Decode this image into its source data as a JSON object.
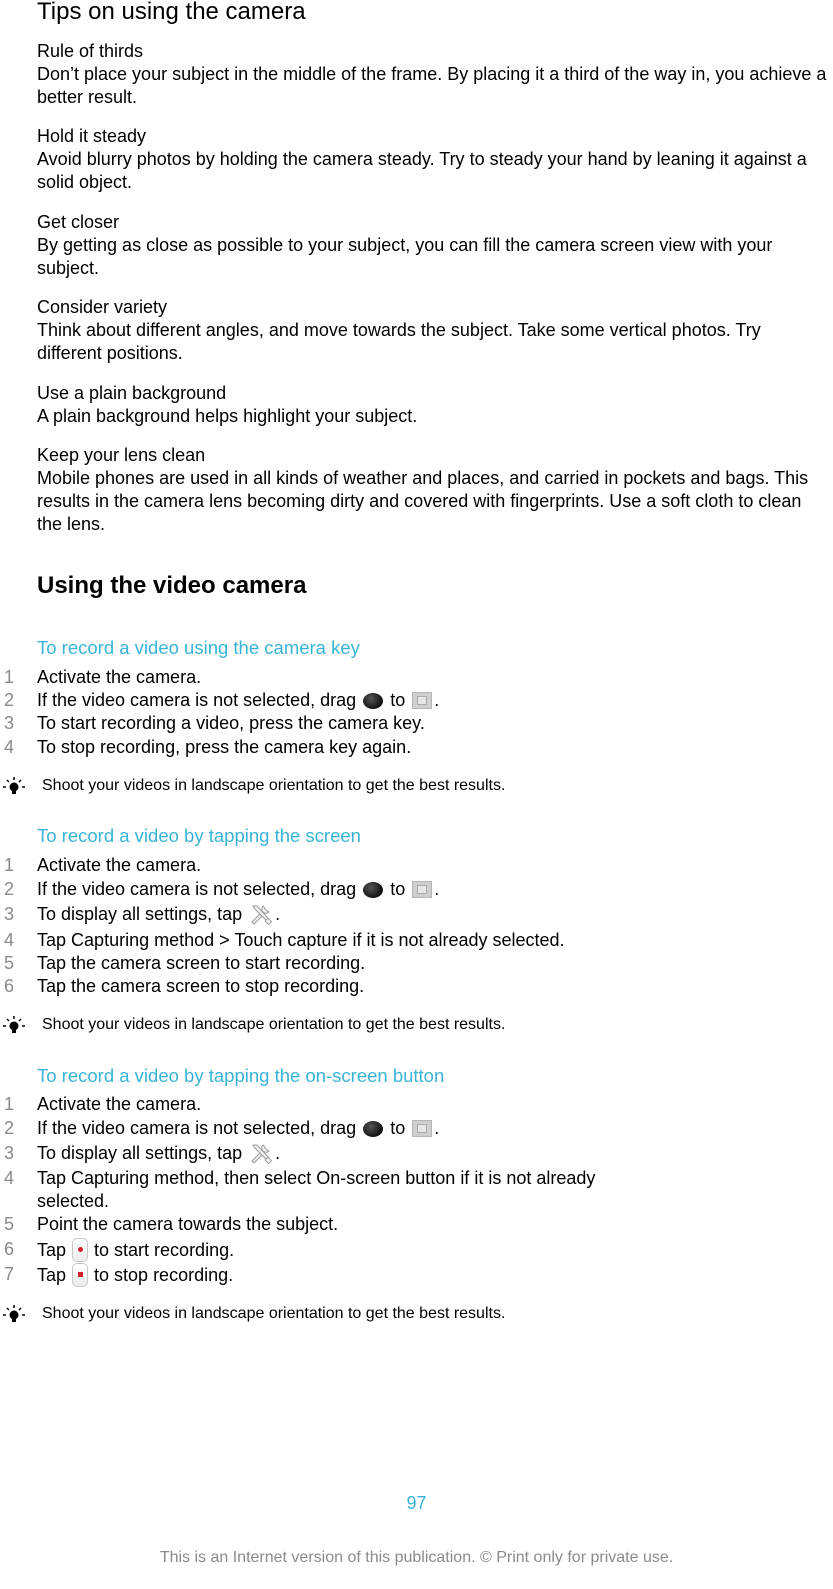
{
  "tips": {
    "title": "Tips on using the camera",
    "items": [
      {
        "heading": "Rule of thirds",
        "body": "Don’t place your subject in the middle of the frame. By placing it a third of the way in, you achieve a better result."
      },
      {
        "heading": "Hold it steady",
        "body": "Avoid blurry photos by holding the camera steady. Try to steady your hand by leaning it against a solid object."
      },
      {
        "heading": "Get closer",
        "body": "By getting as close as possible to your subject, you can fill the camera screen view with your subject."
      },
      {
        "heading": "Consider variety",
        "body": "Think about different angles, and move towards the subject. Take some vertical photos. Try different positions."
      },
      {
        "heading": "Use a plain background",
        "body": "A plain background helps highlight your subject."
      },
      {
        "heading": "Keep your lens clean",
        "body": "Mobile phones are used in all kinds of weather and places, and carried in pockets and bags. This results in the camera lens becoming dirty and covered with fingerprints. Use a soft cloth to clean the lens."
      }
    ]
  },
  "video": {
    "title": "Using the video camera",
    "procedures": [
      {
        "title": "To record a video using the camera key",
        "steps": [
          {
            "n": "1",
            "text": "Activate the camera."
          },
          {
            "n": "2",
            "pre": "If the video camera is not selected, drag",
            "mid": "to",
            "post": "."
          },
          {
            "n": "3",
            "text": "To start recording a video, press the camera key."
          },
          {
            "n": "4",
            "text": "To stop recording, press the camera key again."
          }
        ],
        "note": "Shoot your videos in landscape orientation to get the best results."
      },
      {
        "title": "To record a video by tapping the screen",
        "steps": [
          {
            "n": "1",
            "text": "Activate the camera."
          },
          {
            "n": "2",
            "pre": "If the video camera is not selected, drag",
            "mid": "to",
            "post": "."
          },
          {
            "n": "3",
            "pre": "To display all settings, tap",
            "post": "."
          },
          {
            "n": "4",
            "pre": "Tap",
            "b1": "Capturing method",
            "mid": ">",
            "b2": "Touch capture",
            "post": "if it is not already selected."
          },
          {
            "n": "5",
            "text": "Tap the camera screen to start recording."
          },
          {
            "n": "6",
            "text": "Tap the camera screen to stop recording."
          }
        ],
        "note": "Shoot your videos in landscape orientation to get the best results."
      },
      {
        "title": "To record a video by tapping the on-screen button",
        "steps": [
          {
            "n": "1",
            "text": "Activate the camera."
          },
          {
            "n": "2",
            "pre": "If the video camera is not selected, drag",
            "mid": "to",
            "post": "."
          },
          {
            "n": "3",
            "pre": "To display all settings, tap",
            "post": "."
          },
          {
            "n": "4",
            "pre": "Tap",
            "b1": "Capturing method",
            "mid": ", then select",
            "b2": "On-screen button",
            "post": "if it is not already",
            "line2": "selected."
          },
          {
            "n": "5",
            "text": "Point the camera towards the subject."
          },
          {
            "n": "6",
            "pre": "Tap",
            "post": "to start recording."
          },
          {
            "n": "7",
            "pre": "Tap",
            "post": "to stop recording."
          }
        ],
        "note": "Shoot your videos in landscape orientation to get the best results."
      }
    ]
  },
  "footer": {
    "page_number": "97",
    "notice": "This is an Internet version of this publication. © Print only for private use."
  }
}
